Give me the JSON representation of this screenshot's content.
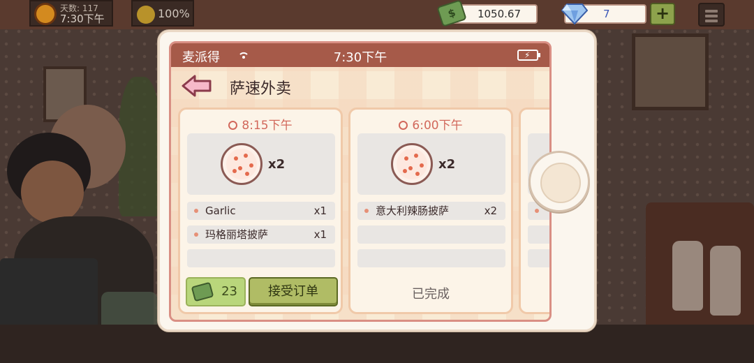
{
  "hud": {
    "days_label": "天数: 117",
    "game_time": "7:30下午",
    "happiness": "100%",
    "money": "1050.67",
    "gems": "7",
    "plus_label": "+"
  },
  "phone": {
    "carrier": "麦派得",
    "clock": "7:30下午",
    "app_title": "萨速外卖",
    "orders": [
      {
        "time": "8:15下午",
        "qty": "x2",
        "items": [
          {
            "name": "Garlic",
            "count": "x1"
          },
          {
            "name": "玛格丽塔披萨",
            "count": "x1"
          }
        ],
        "reward": "23",
        "accept_label": "接受订单"
      },
      {
        "time": "6:00下午",
        "qty": "x2",
        "items": [
          {
            "name": "意大利辣肠披萨",
            "count": "x2"
          }
        ],
        "status": "已完成"
      }
    ]
  },
  "colors": {
    "statusbar": "#a65a49",
    "accent": "#d2685b",
    "accept_button": "#b0bc65"
  },
  "icons": [
    "sun-icon",
    "smile-icon",
    "money-icon",
    "gem-icon",
    "plus-icon",
    "menu-icon",
    "signal-icon",
    "battery-icon",
    "back-arrow-icon",
    "clock-icon",
    "pizza-icon",
    "cash-icon"
  ]
}
